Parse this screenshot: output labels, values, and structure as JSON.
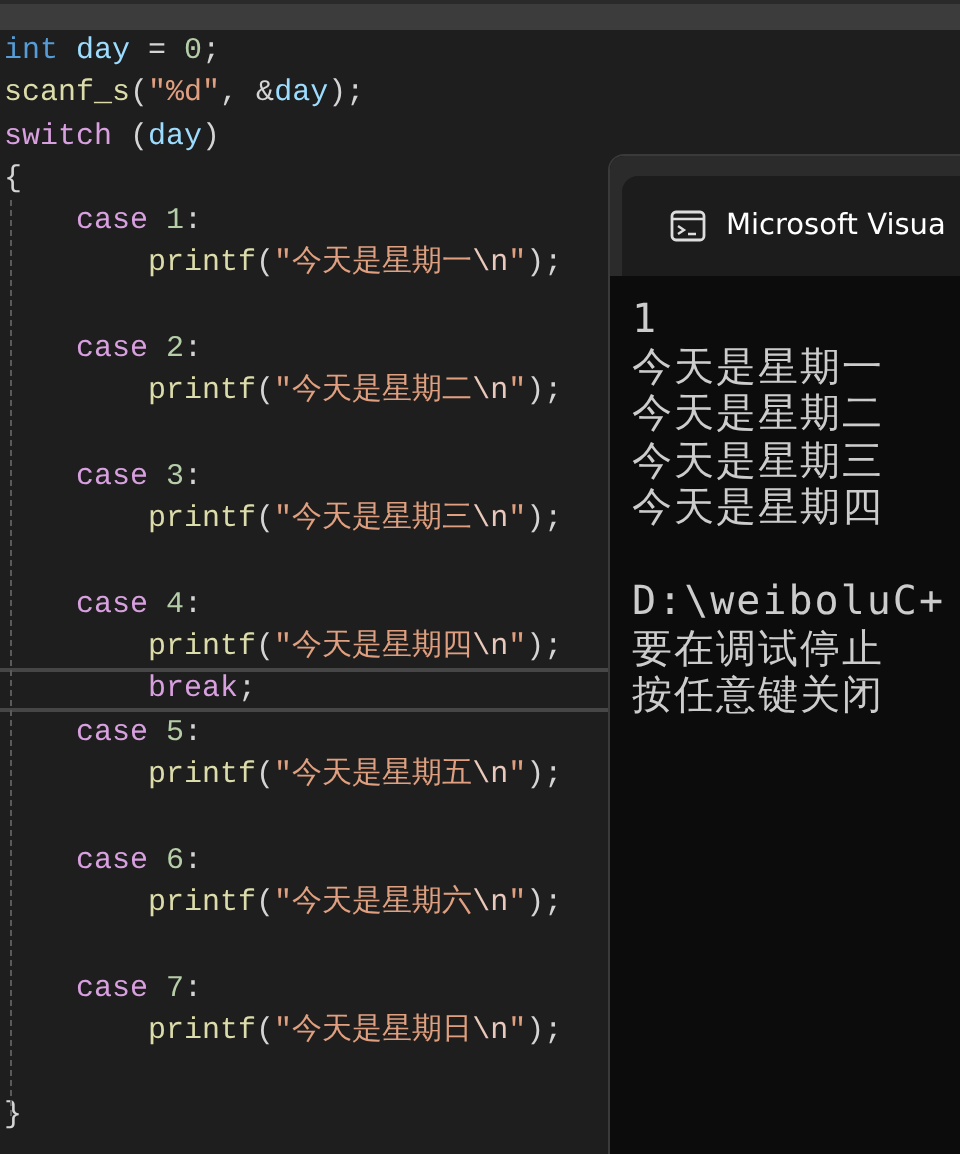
{
  "editor": {
    "lines": [
      {
        "current": false,
        "tokens": [
          {
            "kind": "type",
            "text": "int"
          },
          {
            "kind": "variable",
            "text": " day"
          },
          {
            "kind": "plain",
            "text": " = "
          },
          {
            "kind": "number",
            "text": "0"
          },
          {
            "kind": "plain",
            "text": ";"
          }
        ]
      },
      {
        "current": false,
        "tokens": [
          {
            "kind": "func",
            "text": "scanf_s"
          },
          {
            "kind": "plain",
            "text": "("
          },
          {
            "kind": "string",
            "text": "\"%d\""
          },
          {
            "kind": "plain",
            "text": ", &"
          },
          {
            "kind": "variable",
            "text": "day"
          },
          {
            "kind": "plain",
            "text": ");"
          }
        ]
      },
      {
        "current": false,
        "tokens": [
          {
            "kind": "keyword",
            "text": "switch"
          },
          {
            "kind": "plain",
            "text": " ("
          },
          {
            "kind": "variable",
            "text": "day"
          },
          {
            "kind": "plain",
            "text": ")"
          }
        ]
      },
      {
        "current": false,
        "tokens": [
          {
            "kind": "plain",
            "text": "{"
          }
        ]
      },
      {
        "current": false,
        "tokens": [
          {
            "kind": "keyword",
            "text": "    case"
          },
          {
            "kind": "number",
            "text": " 1"
          },
          {
            "kind": "plain",
            "text": ":"
          }
        ]
      },
      {
        "current": false,
        "tokens": [
          {
            "kind": "func",
            "text": "        printf"
          },
          {
            "kind": "plain",
            "text": "("
          },
          {
            "kind": "string",
            "text": "\"今天是星期一"
          },
          {
            "kind": "escape",
            "text": "\\n"
          },
          {
            "kind": "string",
            "text": "\""
          },
          {
            "kind": "plain",
            "text": ");"
          }
        ]
      },
      {
        "current": false
      },
      {
        "current": false,
        "tokens": [
          {
            "kind": "keyword",
            "text": "    case"
          },
          {
            "kind": "number",
            "text": " 2"
          },
          {
            "kind": "plain",
            "text": ":"
          }
        ]
      },
      {
        "current": false,
        "tokens": [
          {
            "kind": "func",
            "text": "        printf"
          },
          {
            "kind": "plain",
            "text": "("
          },
          {
            "kind": "string",
            "text": "\"今天是星期二"
          },
          {
            "kind": "escape",
            "text": "\\n"
          },
          {
            "kind": "string",
            "text": "\""
          },
          {
            "kind": "plain",
            "text": ");"
          }
        ]
      },
      {
        "current": false
      },
      {
        "current": false,
        "tokens": [
          {
            "kind": "keyword",
            "text": "    case"
          },
          {
            "kind": "number",
            "text": " 3"
          },
          {
            "kind": "plain",
            "text": ":"
          }
        ]
      },
      {
        "current": false,
        "tokens": [
          {
            "kind": "func",
            "text": "        printf"
          },
          {
            "kind": "plain",
            "text": "("
          },
          {
            "kind": "string",
            "text": "\"今天是星期三"
          },
          {
            "kind": "escape",
            "text": "\\n"
          },
          {
            "kind": "string",
            "text": "\""
          },
          {
            "kind": "plain",
            "text": ");"
          }
        ]
      },
      {
        "current": false
      },
      {
        "current": false,
        "tokens": [
          {
            "kind": "keyword",
            "text": "    case"
          },
          {
            "kind": "number",
            "text": " 4"
          },
          {
            "kind": "plain",
            "text": ":"
          }
        ]
      },
      {
        "current": false,
        "tokens": [
          {
            "kind": "func",
            "text": "        printf"
          },
          {
            "kind": "plain",
            "text": "("
          },
          {
            "kind": "string",
            "text": "\"今天是星期四"
          },
          {
            "kind": "escape",
            "text": "\\n"
          },
          {
            "kind": "string",
            "text": "\""
          },
          {
            "kind": "plain",
            "text": ");"
          }
        ]
      },
      {
        "current": true,
        "tokens": [
          {
            "kind": "keyword",
            "text": "        break"
          },
          {
            "kind": "plain",
            "text": ";"
          }
        ]
      },
      {
        "current": false,
        "tokens": [
          {
            "kind": "keyword",
            "text": "    case"
          },
          {
            "kind": "number",
            "text": " 5"
          },
          {
            "kind": "plain",
            "text": ":"
          }
        ]
      },
      {
        "current": false,
        "tokens": [
          {
            "kind": "func",
            "text": "        printf"
          },
          {
            "kind": "plain",
            "text": "("
          },
          {
            "kind": "string",
            "text": "\"今天是星期五"
          },
          {
            "kind": "escape",
            "text": "\\n"
          },
          {
            "kind": "string",
            "text": "\""
          },
          {
            "kind": "plain",
            "text": ");"
          }
        ]
      },
      {
        "current": false
      },
      {
        "current": false,
        "tokens": [
          {
            "kind": "keyword",
            "text": "    case"
          },
          {
            "kind": "number",
            "text": " 6"
          },
          {
            "kind": "plain",
            "text": ":"
          }
        ]
      },
      {
        "current": false,
        "tokens": [
          {
            "kind": "func",
            "text": "        printf"
          },
          {
            "kind": "plain",
            "text": "("
          },
          {
            "kind": "string",
            "text": "\"今天是星期六"
          },
          {
            "kind": "escape",
            "text": "\\n"
          },
          {
            "kind": "string",
            "text": "\""
          },
          {
            "kind": "plain",
            "text": ");"
          }
        ]
      },
      {
        "current": false
      },
      {
        "current": false,
        "tokens": [
          {
            "kind": "keyword",
            "text": "    case"
          },
          {
            "kind": "number",
            "text": " 7"
          },
          {
            "kind": "plain",
            "text": ":"
          }
        ]
      },
      {
        "current": false,
        "tokens": [
          {
            "kind": "func",
            "text": "        printf"
          },
          {
            "kind": "plain",
            "text": "("
          },
          {
            "kind": "string",
            "text": "\"今天是星期日"
          },
          {
            "kind": "escape",
            "text": "\\n"
          },
          {
            "kind": "string",
            "text": "\""
          },
          {
            "kind": "plain",
            "text": ");"
          }
        ]
      },
      {
        "current": false
      },
      {
        "current": false,
        "tokens": [
          {
            "kind": "plain",
            "text": "}"
          }
        ]
      }
    ]
  },
  "console": {
    "title": "Microsoft Visua",
    "output_blocks": [
      [
        "1",
        "今天是星期一",
        "今天是星期二",
        "今天是星期三",
        "今天是星期四"
      ],
      [
        "D:\\weiboluC+",
        "要在调试停止",
        "按任意键关闭"
      ]
    ]
  }
}
